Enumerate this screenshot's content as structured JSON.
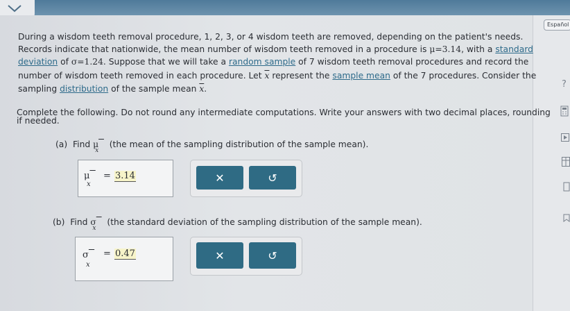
{
  "header": {
    "language_button": "Español"
  },
  "problem": {
    "line1": "During a wisdom teeth removal procedure, 1, 2, 3, or 4 wisdom teeth are removed, depending on the patient's needs.",
    "line2_a": "Records indicate that nationwide, the mean number of wisdom teeth removed in a procedure is ",
    "mu_eq": "μ=3.14",
    "line2_b": ", with a ",
    "link_standard": "standard",
    "link_deviation": "deviation",
    "line3_a": " of ",
    "sigma_eq": "σ=1.24",
    "line3_b": ". Suppose that we will take a ",
    "link_random_sample": "random sample",
    "line3_c": " of 7 wisdom teeth removal procedures and record the",
    "line4_a": "number of wisdom teeth removed in each procedure. Let ",
    "xbar": "x",
    "line4_b": " represent the ",
    "link_sample_mean": "sample mean",
    "line4_c": " of the 7 procedures. Consider the",
    "line5_a": "sampling ",
    "link_distribution": "distribution",
    "line5_b": " of the sample mean ",
    "line5_c": "."
  },
  "instructions": {
    "line1": "Complete the following. Do not round any intermediate computations. Write your answers with two decimal places, rounding",
    "line2": "if needed."
  },
  "part_a": {
    "label": "(a)",
    "find": "Find",
    "symbol": "μ",
    "description": "(the mean of the sampling distribution of the sample mean).",
    "answer_symbol": "μ",
    "equals": "=",
    "answer_value": "3.14",
    "clear_icon": "✕",
    "undo_icon": "↺"
  },
  "part_b": {
    "label": "(b)",
    "find": "Find",
    "symbol": "σ",
    "description": "(the standard deviation of the sampling distribution of the sample mean).",
    "answer_symbol": "σ",
    "equals": "=",
    "answer_value": "0.47",
    "clear_icon": "✕",
    "undo_icon": "↺"
  },
  "subscript": "x",
  "sidebar": {
    "help_icon": "?"
  }
}
